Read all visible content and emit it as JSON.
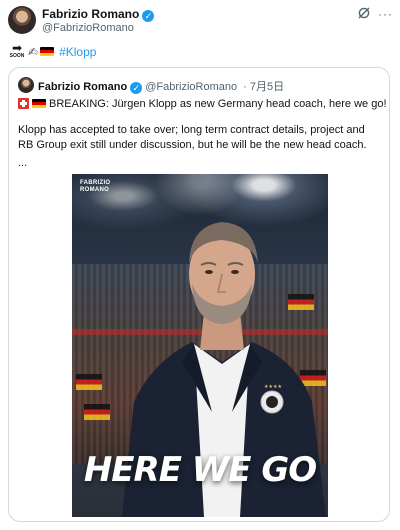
{
  "author": {
    "name": "Fabrizio Romano",
    "handle": "@FabrizioRomano"
  },
  "tweet": {
    "soon_label": "SOON",
    "hashtag": "#Klopp"
  },
  "quoted": {
    "name": "Fabrizio Romano",
    "handle": "@FabrizioRomano",
    "date": "· 7月5日",
    "line1": "BREAKING: Jürgen Klopp as new Germany head coach, here we go!",
    "body": "Klopp has accepted to take over; long term contract details, project and RB Group exit still under discussion, but he will be the new head coach.",
    "ellipsis": "..."
  },
  "media": {
    "brand_line1": "FABRIZIO",
    "brand_line2": "ROMANO",
    "headline": "HERE WE GO"
  },
  "colors": {
    "link": "#1d9bf0",
    "verified": "#1d9bf0",
    "text": "#0f1419",
    "muted": "#536471",
    "border": "#cfd9de"
  },
  "icons": [
    "verified-badge-icon",
    "grok-icon",
    "more-icon",
    "soon-arrow-icon",
    "pen-icon",
    "germany-flag-icon",
    "switzerland-flag-icon",
    "collision-icon"
  ]
}
